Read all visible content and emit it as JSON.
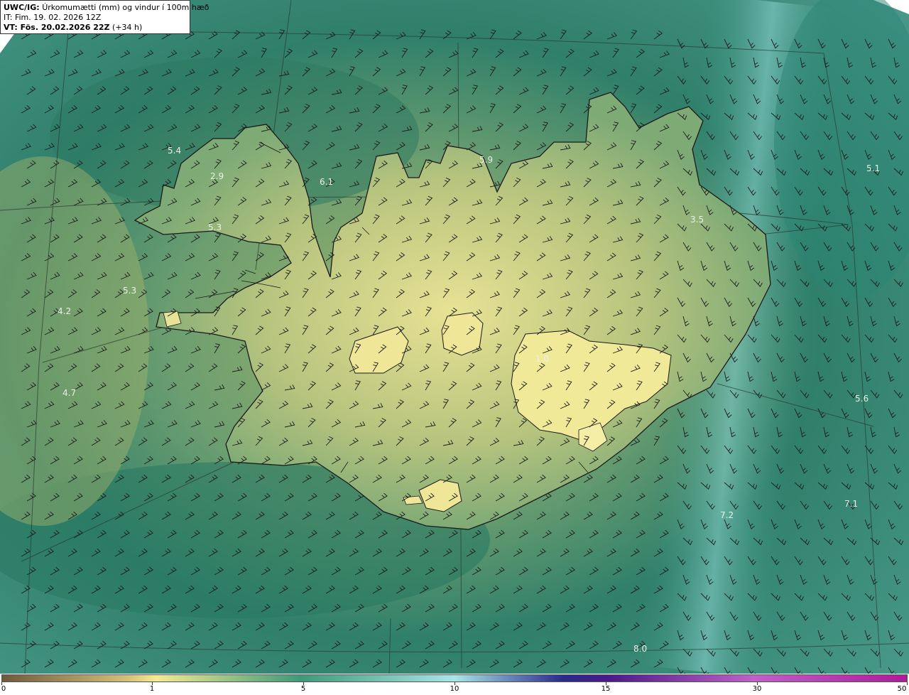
{
  "header": {
    "model_tag": "UWC/IG:",
    "title": "Úrkomumætti (mm) og vindur í 100m hæð",
    "it_line": "IT: Fim. 19. 02. 2026 12Z",
    "vt_tag": "VT: Fös. 20.02.2026 22Z",
    "vt_suffix": "(+34 h)"
  },
  "map_labels": [
    {
      "text": "5.4"
    },
    {
      "text": "2.9"
    },
    {
      "text": "5.3"
    },
    {
      "text": "6.1"
    },
    {
      "text": "5.9"
    },
    {
      "text": "5.1"
    },
    {
      "text": "3.5"
    },
    {
      "text": "5.3"
    },
    {
      "text": "4.2"
    },
    {
      "text": "4.7"
    },
    {
      "text": "1.0"
    },
    {
      "text": "5.6"
    },
    {
      "text": "7.2"
    },
    {
      "text": "7.1"
    },
    {
      "text": "8.0"
    }
  ],
  "colorbar": {
    "ticks": [
      "0",
      "1",
      "5",
      "10",
      "15",
      "30",
      "50"
    ],
    "colors": [
      "#6e5a3c",
      "#d4c27a",
      "#f3eb93",
      "#3f9a78",
      "#a8e6e8",
      "#2a2a8c",
      "#4a1a8a",
      "#c060c8",
      "#b01a9a"
    ]
  }
}
